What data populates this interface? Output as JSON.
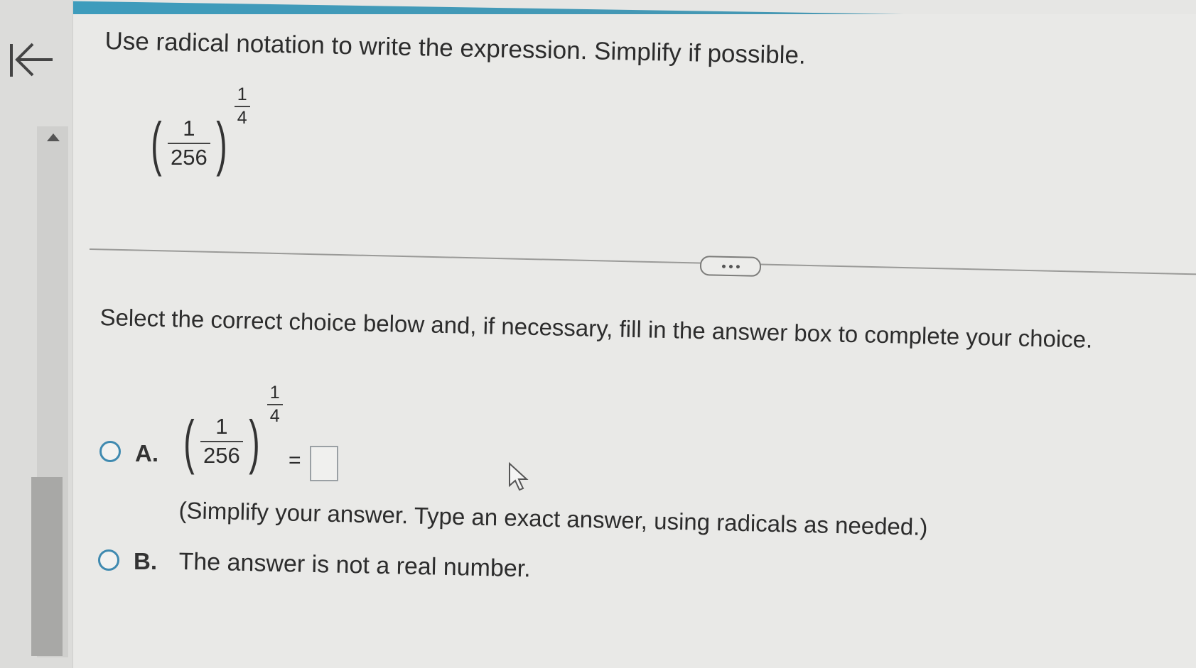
{
  "nav": {
    "back_icon": "arrow-left-to-bar-icon"
  },
  "question": {
    "prompt": "Use radical notation to write the expression. Simplify if possible.",
    "expression": {
      "numerator": "1",
      "denominator": "256",
      "exp_numerator": "1",
      "exp_denominator": "4"
    }
  },
  "more_button_icon": "ellipsis-icon",
  "instruction": "Select the correct choice below and, if necessary, fill in the answer box to complete your choice.",
  "choices": [
    {
      "letter": "A.",
      "expression": {
        "numerator": "1",
        "denominator": "256",
        "exp_numerator": "1",
        "exp_denominator": "4",
        "equals": "="
      },
      "answer_value": "",
      "hint": "(Simplify your answer. Type an exact answer, using radicals as needed.)"
    },
    {
      "letter": "B.",
      "text": "The answer is not a real number."
    }
  ],
  "colors": {
    "header": "#3d9cbd",
    "radio_border": "#3f8ab0",
    "background": "#e9e9e7"
  }
}
